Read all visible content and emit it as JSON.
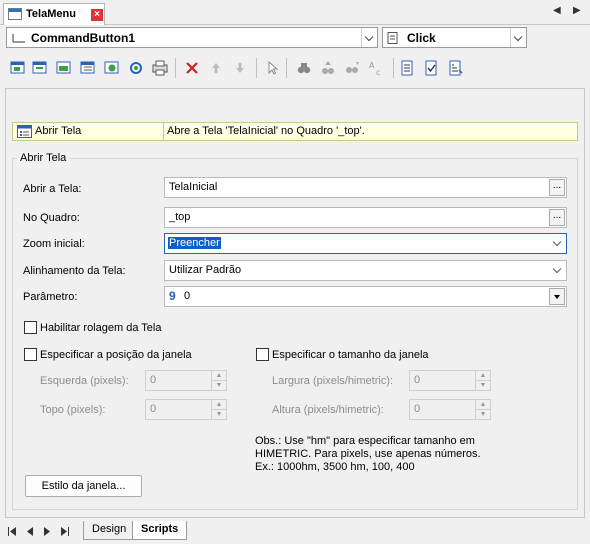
{
  "window": {
    "tab_title": "TelaMenu",
    "nav_prev": "◀",
    "nav_next": "▶"
  },
  "object_combo": {
    "value": "CommandButton1"
  },
  "event_combo": {
    "value": "Click"
  },
  "toolbar": {
    "icons": [
      "add-action-icon",
      "add-script-icon",
      "add-picture-icon",
      "add-table-icon",
      "add-link-icon",
      "add-gear-icon",
      "add-print-icon",
      "delete-icon",
      "move-up-icon",
      "move-down-icon",
      "cursor-icon",
      "find-icon",
      "find-up-icon",
      "find-down-icon",
      "replace-icon",
      "doc-list-icon",
      "doc-check-icon",
      "doc-format-icon"
    ]
  },
  "action_row": {
    "name": "Abrir Tela",
    "description": "Abre a Tela 'TelaInicial' no Quadro '_top'."
  },
  "group": {
    "title": "Abrir Tela",
    "abrir_tela_label": "Abrir a Tela:",
    "abrir_tela_value": "TelaInicial",
    "quadro_label": "No Quadro:",
    "quadro_value": "_top",
    "zoom_label": "Zoom inicial:",
    "zoom_value": "Preencher",
    "alinhamento_label": "Alinhamento da Tela:",
    "alinhamento_value": "Utilizar Padrão",
    "parametro_label": "Parâmetro:",
    "parametro_type": "9",
    "parametro_value": "0",
    "ellipsis": "...",
    "rolagem_label": "Habilitar rolagem da Tela",
    "posicao_label": "Especificar a posição da janela",
    "esquerda_label": "Esquerda (pixels):",
    "esquerda_value": "0",
    "topo_label": "Topo (pixels):",
    "topo_value": "0",
    "tamanho_label": "Especificar o tamanho da janela",
    "largura_label": "Largura (pixels/himetric):",
    "largura_value": "0",
    "altura_label": "Altura (pixels/himetric):",
    "altura_value": "0",
    "obs_line1": "Obs.: Use \"hm\" para especificar tamanho em",
    "obs_line2": "HIMETRIC. Para pixels, use apenas números.",
    "obs_line3": "Ex.: 1000hm, 3500 hm, 100, 400",
    "estilo_button": "Estilo da janela..."
  },
  "bottom_tabs": {
    "design": "Design",
    "scripts": "Scripts"
  }
}
